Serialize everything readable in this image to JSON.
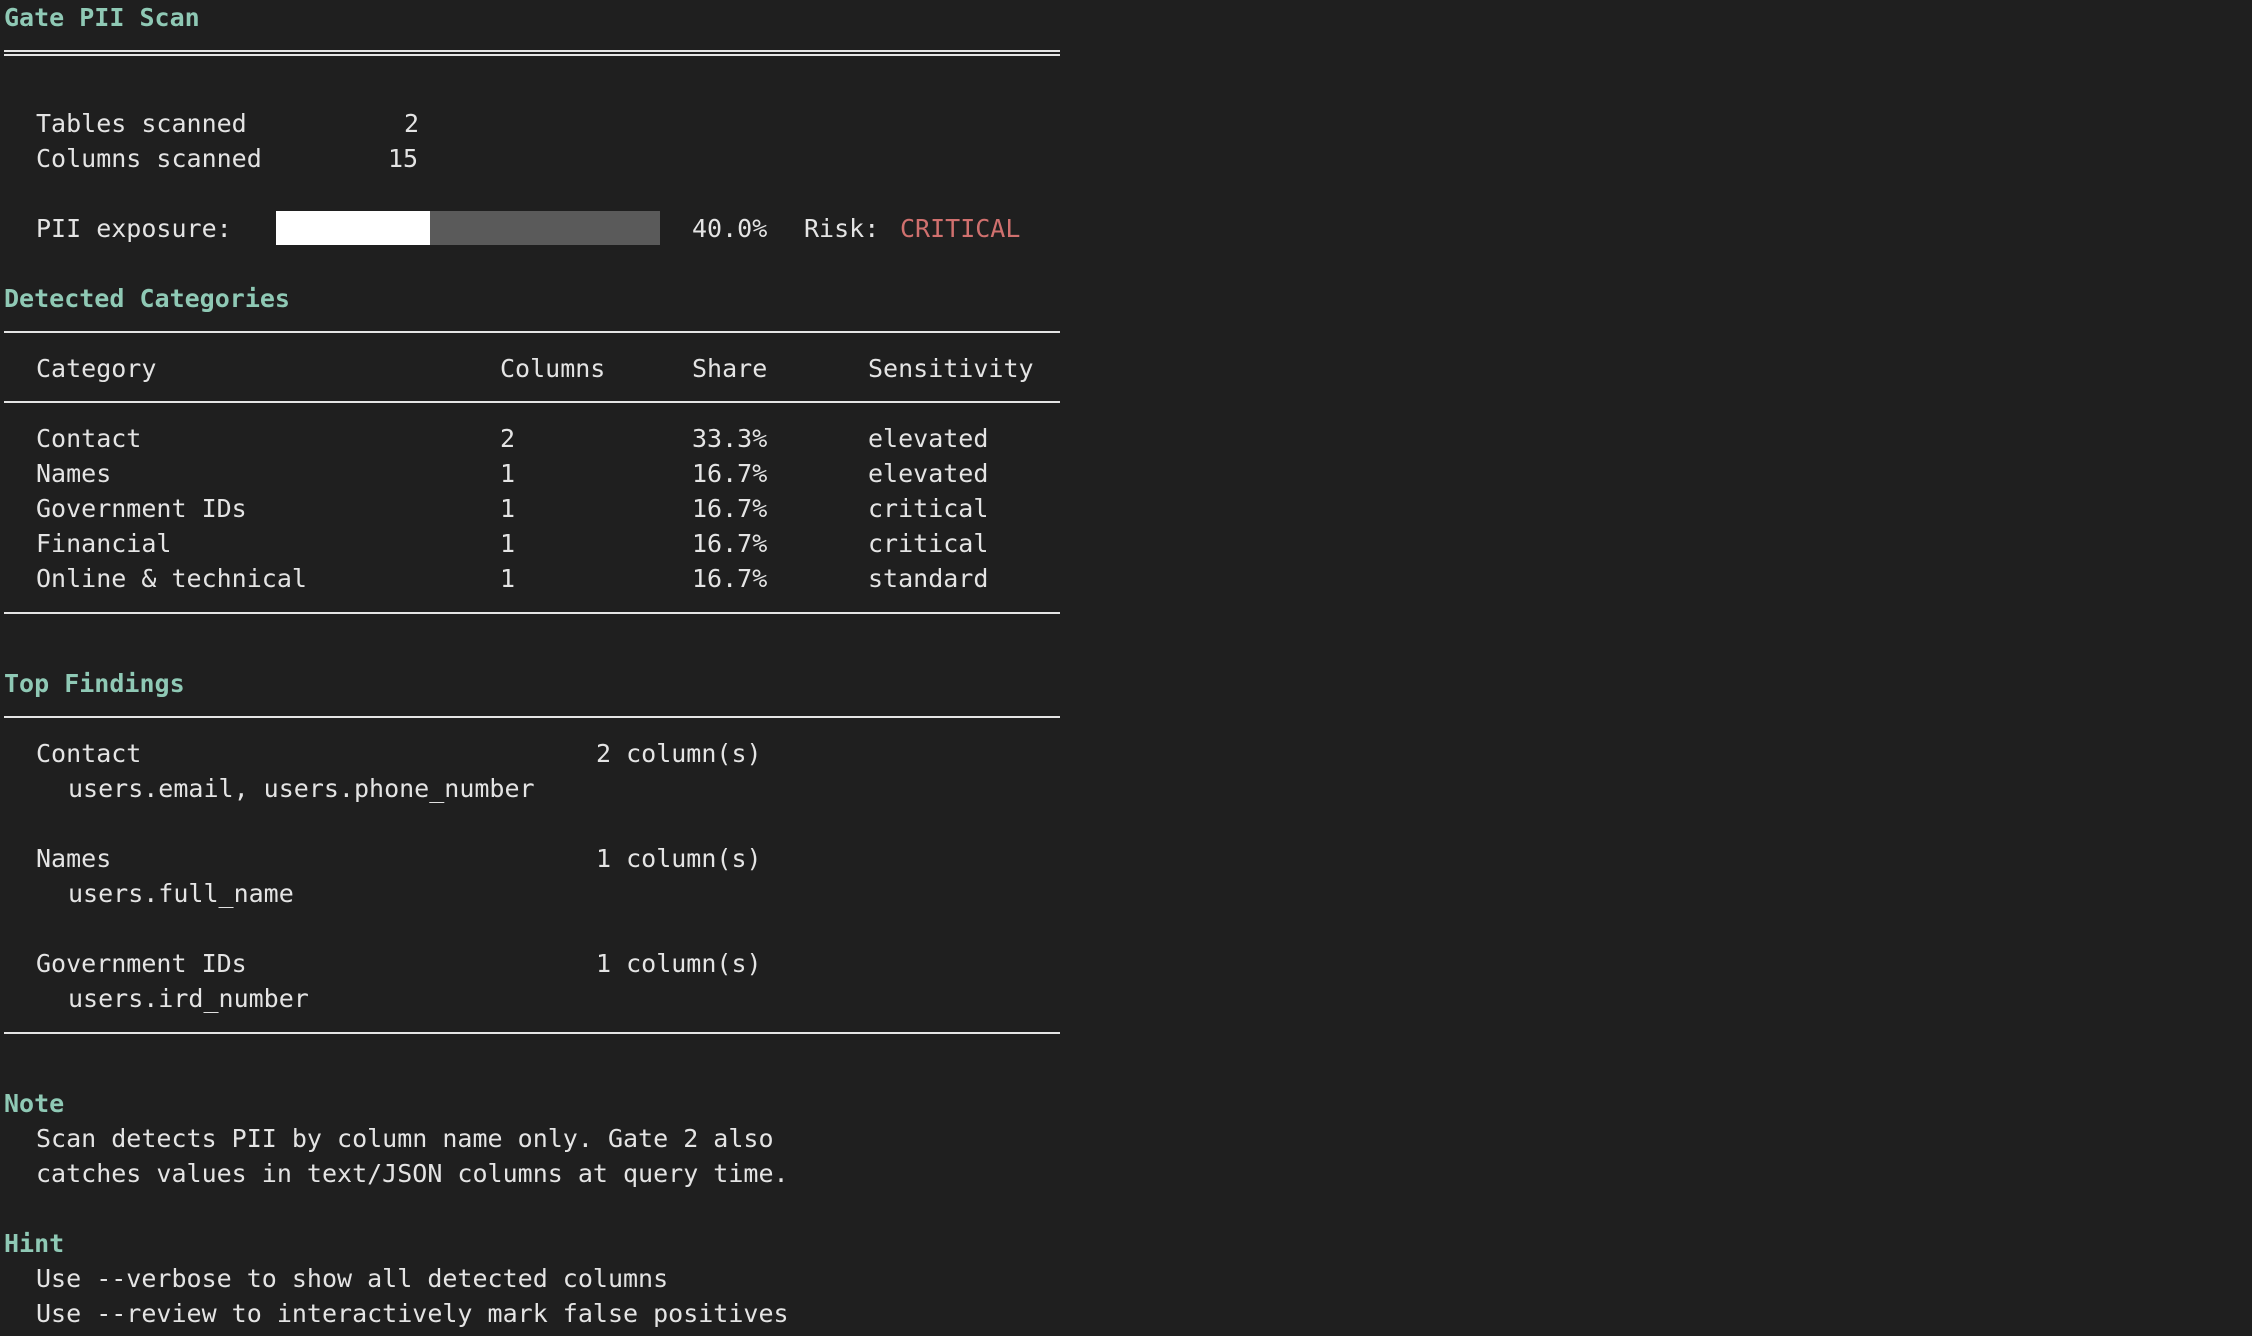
{
  "title": "Gate PII Scan",
  "summary": {
    "tables_label": "Tables scanned",
    "tables_value": "2",
    "columns_label": "Columns scanned",
    "columns_value": "15",
    "exposure_label": "PII exposure:",
    "exposure_fraction": 0.4,
    "exposure_text": "40.0%",
    "risk_label": "Risk:",
    "risk_value": "CRITICAL"
  },
  "categories": {
    "heading": "Detected Categories",
    "headers": {
      "category": "Category",
      "columns": "Columns",
      "share": "Share",
      "sensitivity": "Sensitivity"
    },
    "rows": [
      {
        "category": "Contact",
        "columns": "2",
        "share": "33.3%",
        "sensitivity": "elevated"
      },
      {
        "category": "Names",
        "columns": "1",
        "share": "16.7%",
        "sensitivity": "elevated"
      },
      {
        "category": "Government IDs",
        "columns": "1",
        "share": "16.7%",
        "sensitivity": "critical"
      },
      {
        "category": "Financial",
        "columns": "1",
        "share": "16.7%",
        "sensitivity": "critical"
      },
      {
        "category": "Online & technical",
        "columns": "1",
        "share": "16.7%",
        "sensitivity": "standard"
      }
    ]
  },
  "findings": {
    "heading": "Top Findings",
    "items": [
      {
        "category": "Contact",
        "count": "2 column(s)",
        "columns": "users.email, users.phone_number"
      },
      {
        "category": "Names",
        "count": "1 column(s)",
        "columns": "users.full_name"
      },
      {
        "category": "Government IDs",
        "count": "1 column(s)",
        "columns": "users.ird_number"
      }
    ]
  },
  "note": {
    "heading": "Note",
    "lines": [
      "Scan detects PII by column name only. Gate 2 also",
      "catches values in text/JSON columns at query time."
    ]
  },
  "hint": {
    "heading": "Hint",
    "lines": [
      "Use --verbose to show all detected columns",
      "Use --review to interactively mark false positives"
    ]
  },
  "colors": {
    "background": "#1f1f1f",
    "text": "#e4e4e4",
    "heading": "#8fc9b5",
    "risk_critical": "#d0706e",
    "bar_fill": "#ffffff",
    "bar_track": "#5a5a5a"
  }
}
